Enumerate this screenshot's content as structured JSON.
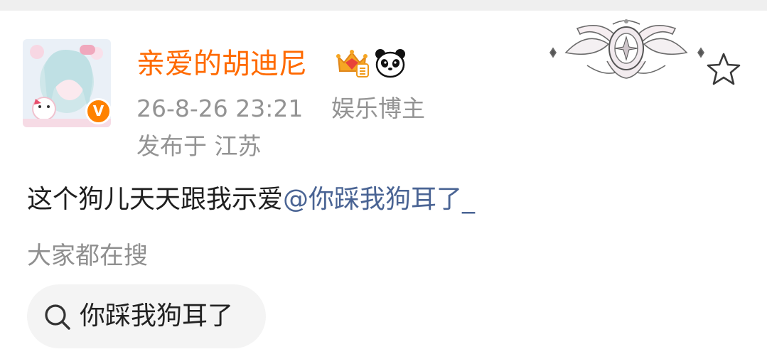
{
  "post": {
    "author": {
      "name": "亲爱的胡迪尼",
      "verified_badge": "V",
      "icons": [
        "crown-badge-icon",
        "panda-icon"
      ]
    },
    "time": "26-8-26 23:21",
    "role": "娱乐博主",
    "location": "发布于 江苏",
    "text_prefix": "这个狗儿天天跟我示爱",
    "mention": "@你踩我狗耳了_"
  },
  "trending": {
    "title": "大家都在搜",
    "items": [
      {
        "label": "你踩我狗耳了",
        "icon": "search-icon"
      }
    ]
  },
  "colors": {
    "username": "#ff6a00",
    "mention": "#4a6494",
    "meta": "#939393",
    "chip_bg": "#f4f4f4",
    "badge": "#ff8200"
  }
}
